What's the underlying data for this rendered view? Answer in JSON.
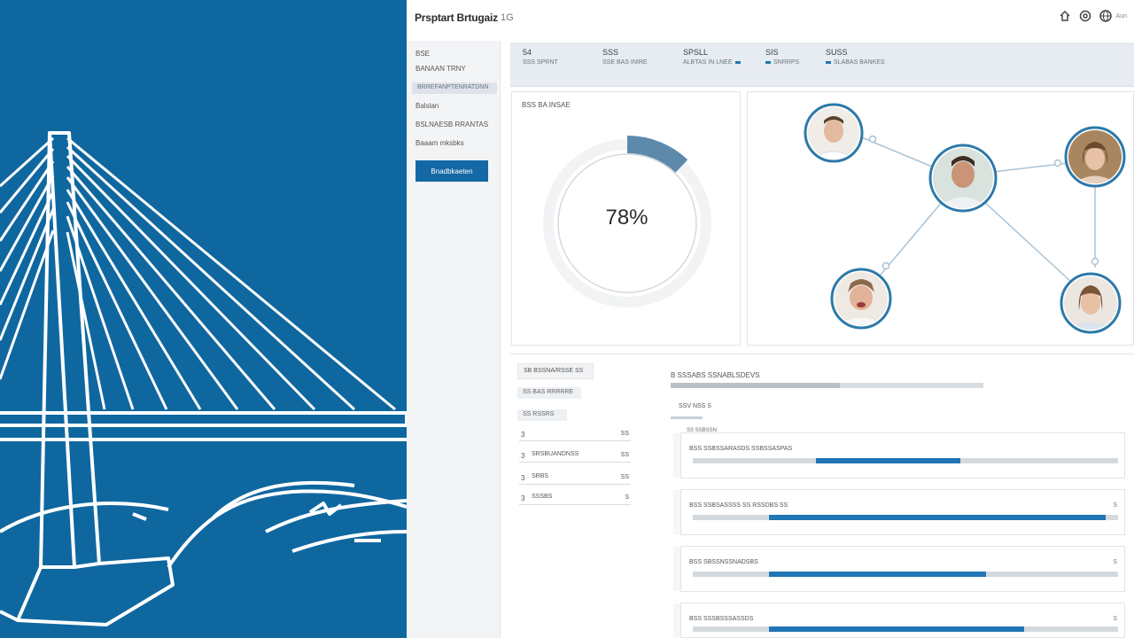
{
  "app": {
    "title": "Prsptart Brtugaiz",
    "subtitle": "1G"
  },
  "topbar": {
    "icons": [
      "home-icon",
      "settings-icon",
      "globe-icon"
    ],
    "user": "Aun"
  },
  "sidebar": {
    "items": [
      {
        "label": "BSE",
        "active": false
      },
      {
        "label": "BANAAN TRNY",
        "active": false
      },
      {
        "label": "BRREFANPTENRATDNN",
        "active": true
      },
      {
        "label": "Balslan",
        "active": false
      },
      {
        "label": "BSLNAESB RRANTAS",
        "active": false
      },
      {
        "label": "Baaam mksbks",
        "active": false
      }
    ],
    "button_label": "Bnadbkaeten"
  },
  "stats": [
    {
      "value": "54",
      "label": "SSS SPRNT"
    },
    {
      "value": "SSS",
      "label": "SSE BAS INIRE"
    },
    {
      "value": "SPSLL",
      "label": "ALBTAS IN LNEE"
    },
    {
      "value": "SIS",
      "label": "SNRRPS"
    },
    {
      "value": "SUSS",
      "label": "SLABAS BANKES"
    }
  ],
  "progress": {
    "title": "BSS BA INSAE",
    "value_text": "78%",
    "fraction": 0.78,
    "colors": {
      "accent": "#5d8aab",
      "track": "#eef1f4"
    }
  },
  "network": {
    "nodes": [
      "avatar-1",
      "avatar-2",
      "avatar-3",
      "avatar-4",
      "avatar-5"
    ],
    "colors": {
      "ring": "#2d79a9",
      "link": "#a9c3d6"
    }
  },
  "list": {
    "header": "SB BSSNA/RSSE SS",
    "chip1": "SS BAS RRRRRE",
    "chip2": "SS RSSRS",
    "rows": [
      {
        "index": "3",
        "label": "",
        "end": "SS"
      },
      {
        "index": "3",
        "label": "SRSBUANDNSS",
        "end": "SS"
      },
      {
        "index": "3",
        "label": "SRBS",
        "end": "SS"
      },
      {
        "index": "3",
        "label": "SSSBS",
        "end": "S"
      }
    ]
  },
  "tasks": {
    "title": "B SSSABS SSNABLSDEVS",
    "overall_fraction": 0.54,
    "subheading": "SSV NSS S",
    "section_label": "SS SSBSSN",
    "items": [
      {
        "label": "BSS SSBSSARASDS SSBSSASPAS",
        "start": 0.29,
        "end": 0.63,
        "end_mark": ""
      },
      {
        "label": "BSS SSBSASSSS SS RSSDBS SS",
        "start": 0.18,
        "end": 0.97,
        "end_mark": "S"
      },
      {
        "label": "BSS SBSSNSSNADSBS",
        "start": 0.18,
        "end": 0.69,
        "end_mark": "S"
      },
      {
        "label": "BSS SSSBSSSASSDS",
        "start": 0.18,
        "end": 0.78,
        "end_mark": "S"
      }
    ],
    "colors": {
      "fill": "#1f75b5"
    }
  },
  "hero": {
    "colors": {
      "background": "#0f67a0",
      "lines": "#ffffff"
    }
  }
}
